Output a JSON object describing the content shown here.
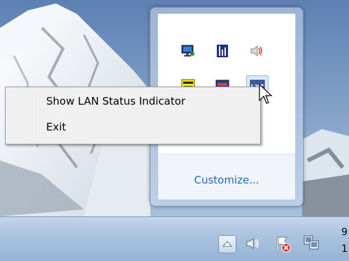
{
  "context_menu": {
    "items": [
      {
        "label": "Show LAN Status Indicator"
      },
      {
        "label": "Exit"
      }
    ]
  },
  "notification_flyout": {
    "customize_label": "Customize...",
    "icons": [
      "network-monitor-icon",
      "lxi-instrument-icon",
      "volume-icon",
      "visa-icon",
      "status-app-icon",
      "lan-status-indicator-icon"
    ]
  },
  "taskbar": {
    "clock_digit_top": "9",
    "clock_digit_bottom": "1",
    "icons": [
      "show-hidden-icons-icon",
      "volume-icon",
      "action-center-flag-icon",
      "network-icon"
    ]
  },
  "colors": {
    "link": "#1e6bb8",
    "menu_bg": "#f0f0f0",
    "taskbar": "#a9c2de"
  }
}
